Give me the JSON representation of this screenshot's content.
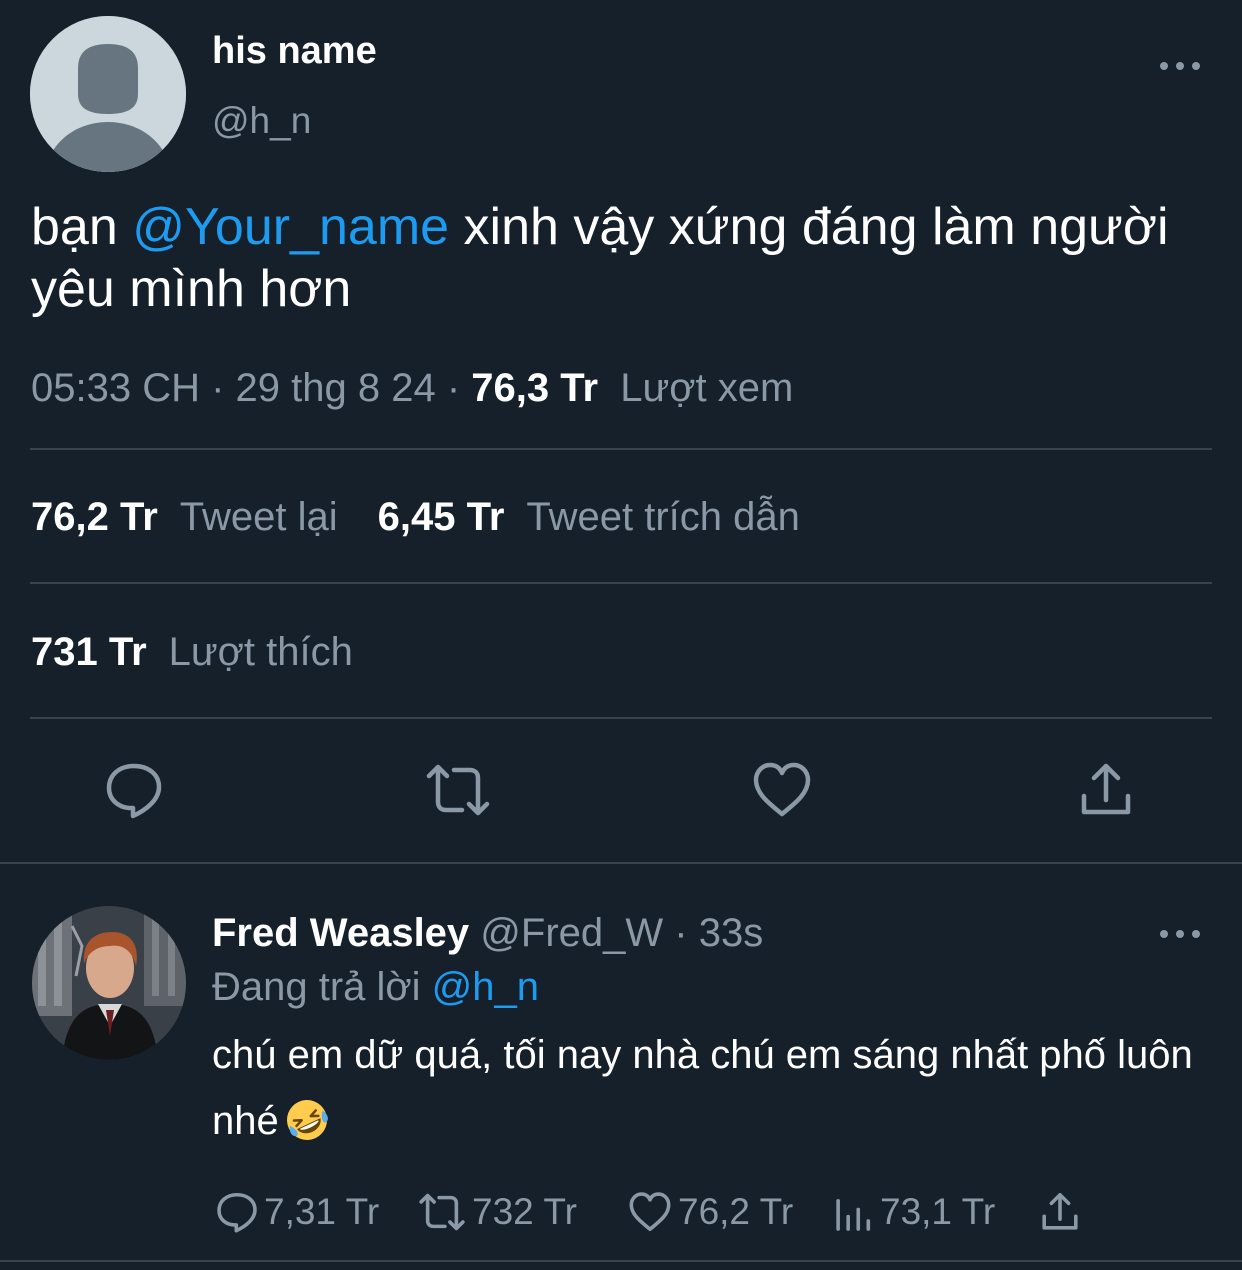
{
  "tweet": {
    "author_name": "his name",
    "author_handle": "@h_n",
    "text_before": "bạn ",
    "mention": "@Your_name",
    "text_after": " xinh vậy xứng đáng làm người yêu mình hơn",
    "time": "05:33 CH",
    "sep1": " · ",
    "date": "29 thg 8 24",
    "sep2": " · ",
    "views": "76,3 Tr",
    "views_label": "Lượt xem"
  },
  "stats": {
    "retweets": "76,2 Tr",
    "retweets_label": "Tweet lại",
    "quotes": "6,45 Tr",
    "quotes_label": "Tweet trích dẫn",
    "likes": "731 Tr",
    "likes_label": "Lượt thích"
  },
  "icons": {
    "more": "more-horizontal-icon",
    "reply": "reply-icon",
    "retweet": "retweet-icon",
    "like": "heart-icon",
    "share": "share-icon",
    "views": "analytics-icon"
  },
  "reply": {
    "name": "Fred Weasley",
    "handle": "@Fred_W",
    "sep": " · ",
    "time": "33s",
    "replying_prefix": "Đang trả lời ",
    "replying_to": "@h_n",
    "text": "chú em dữ quá, tối nay nhà chú em sáng nhất phố luôn nhé",
    "emoji": "🤣",
    "replies": "7,31 Tr",
    "retweets": "732 Tr",
    "likes": "76,2 Tr",
    "views": "73,1 Tr"
  },
  "colors": {
    "background": "#15202b",
    "text_primary": "#ffffff",
    "text_secondary": "#8b98a5",
    "accent": "#1d9bf0",
    "divider": "#38444d"
  }
}
